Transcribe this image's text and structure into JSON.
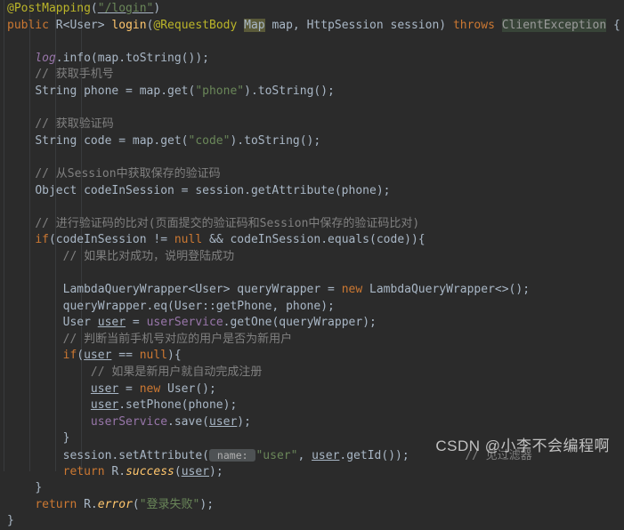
{
  "editor": {
    "language": "java",
    "theme": "darcula",
    "background": "#2b2b2b",
    "default_text_color": "#a9b7c6",
    "colors": {
      "keyword": "#cc7832",
      "annotation": "#bbb529",
      "string": "#6a8759",
      "comment": "#808080",
      "field": "#9876aa",
      "method": "#ffc66d",
      "identifier": "#a9b7c6",
      "usage_highlight_bg": "#5a5a39",
      "exception_highlight_bg": "#384438",
      "param_hint_bg": "#4e5254"
    },
    "indent_guides": [
      4,
      33,
      62,
      91
    ]
  },
  "code": {
    "lines": [
      {
        "indent": 0,
        "tokens": [
          {
            "t": "@PostMapping",
            "c": "ann"
          },
          {
            "t": "(",
            "c": "id"
          },
          {
            "t": "\"/login\"",
            "c": "str",
            "underline": true
          },
          {
            "t": ")",
            "c": "id"
          }
        ]
      },
      {
        "indent": 0,
        "tokens": [
          {
            "t": "public",
            "c": "kw"
          },
          {
            "t": " R<User> ",
            "c": "id"
          },
          {
            "t": "login",
            "c": "mtd"
          },
          {
            "t": "(",
            "c": "id"
          },
          {
            "t": "@RequestBody",
            "c": "ann"
          },
          {
            "t": " ",
            "c": "id"
          },
          {
            "t": "Map",
            "c": "hl-map"
          },
          {
            "t": " map, HttpSession session) ",
            "c": "id"
          },
          {
            "t": "throws",
            "c": "kw"
          },
          {
            "t": " ",
            "c": "id"
          },
          {
            "t": "ClientException",
            "c": "hl-exc"
          },
          {
            "t": " {",
            "c": "id"
          }
        ]
      },
      {
        "indent": 0,
        "tokens": []
      },
      {
        "indent": 1,
        "tokens": [
          {
            "t": "log",
            "c": "stat"
          },
          {
            "t": ".info(map.toString());",
            "c": "id"
          }
        ]
      },
      {
        "indent": 1,
        "tokens": [
          {
            "t": "// 获取手机号",
            "c": "cmt"
          }
        ]
      },
      {
        "indent": 1,
        "tokens": [
          {
            "t": "String phone = map.get(",
            "c": "id"
          },
          {
            "t": "\"phone\"",
            "c": "str"
          },
          {
            "t": ").toString();",
            "c": "id"
          }
        ]
      },
      {
        "indent": 0,
        "tokens": []
      },
      {
        "indent": 1,
        "tokens": [
          {
            "t": "// 获取验证码",
            "c": "cmt"
          }
        ]
      },
      {
        "indent": 1,
        "tokens": [
          {
            "t": "String code = map.get(",
            "c": "id"
          },
          {
            "t": "\"code\"",
            "c": "str"
          },
          {
            "t": ").toString();",
            "c": "id"
          }
        ]
      },
      {
        "indent": 0,
        "tokens": []
      },
      {
        "indent": 1,
        "tokens": [
          {
            "t": "// 从Session中获取保存的验证码",
            "c": "cmt"
          }
        ]
      },
      {
        "indent": 1,
        "tokens": [
          {
            "t": "Object codeInSession = session.getAttribute(phone);",
            "c": "id"
          }
        ]
      },
      {
        "indent": 0,
        "tokens": []
      },
      {
        "indent": 1,
        "tokens": [
          {
            "t": "// 进行验证码的比对(页面提交的验证码和Session中保存的验证码比对)",
            "c": "cmt"
          }
        ]
      },
      {
        "indent": 1,
        "tokens": [
          {
            "t": "if",
            "c": "kw"
          },
          {
            "t": "(codeInSession != ",
            "c": "id"
          },
          {
            "t": "null",
            "c": "kw"
          },
          {
            "t": " && codeInSession.equals(code)){",
            "c": "id"
          }
        ]
      },
      {
        "indent": 2,
        "tokens": [
          {
            "t": "// 如果比对成功，说明登陆成功",
            "c": "cmt"
          }
        ]
      },
      {
        "indent": 0,
        "tokens": []
      },
      {
        "indent": 2,
        "tokens": [
          {
            "t": "LambdaQueryWrapper<User> queryWrapper = ",
            "c": "id"
          },
          {
            "t": "new",
            "c": "kw"
          },
          {
            "t": " LambdaQueryWrapper<>();",
            "c": "id"
          }
        ]
      },
      {
        "indent": 2,
        "tokens": [
          {
            "t": "queryWrapper.eq(User::getPhone, phone);",
            "c": "id"
          }
        ]
      },
      {
        "indent": 2,
        "tokens": [
          {
            "t": "User ",
            "c": "id"
          },
          {
            "t": "user",
            "c": "id",
            "underline": true
          },
          {
            "t": " = ",
            "c": "id"
          },
          {
            "t": "userService",
            "c": "fld"
          },
          {
            "t": ".getOne(queryWrapper);",
            "c": "id"
          }
        ]
      },
      {
        "indent": 2,
        "tokens": [
          {
            "t": "// 判断当前手机号对应的用户是否为新用户",
            "c": "cmt"
          }
        ]
      },
      {
        "indent": 2,
        "tokens": [
          {
            "t": "if",
            "c": "kw"
          },
          {
            "t": "(",
            "c": "id"
          },
          {
            "t": "user",
            "c": "id",
            "underline": true
          },
          {
            "t": " == ",
            "c": "id"
          },
          {
            "t": "null",
            "c": "kw"
          },
          {
            "t": "){",
            "c": "id"
          }
        ]
      },
      {
        "indent": 3,
        "tokens": [
          {
            "t": "// 如果是新用户就自动完成注册",
            "c": "cmt"
          }
        ]
      },
      {
        "indent": 3,
        "tokens": [
          {
            "t": "user",
            "c": "id",
            "underline": true
          },
          {
            "t": " = ",
            "c": "id"
          },
          {
            "t": "new",
            "c": "kw"
          },
          {
            "t": " User();",
            "c": "id"
          }
        ]
      },
      {
        "indent": 3,
        "tokens": [
          {
            "t": "user",
            "c": "id",
            "underline": true
          },
          {
            "t": ".setPhone(phone);",
            "c": "id"
          }
        ]
      },
      {
        "indent": 3,
        "tokens": [
          {
            "t": "userService",
            "c": "fld"
          },
          {
            "t": ".save(",
            "c": "id"
          },
          {
            "t": "user",
            "c": "id",
            "underline": true
          },
          {
            "t": ");",
            "c": "id"
          }
        ]
      },
      {
        "indent": 2,
        "tokens": [
          {
            "t": "}",
            "c": "id"
          }
        ]
      },
      {
        "indent": 2,
        "tokens": [
          {
            "t": "session.setAttribute(",
            "c": "id"
          },
          {
            "t": " name: ",
            "c": "hint"
          },
          {
            "t": "\"user\"",
            "c": "str"
          },
          {
            "t": ", ",
            "c": "id"
          },
          {
            "t": "user",
            "c": "id",
            "underline": true
          },
          {
            "t": ".getId());",
            "c": "id"
          },
          {
            "t": "        ",
            "c": "id"
          },
          {
            "t": "// 见过滤器",
            "c": "cmt"
          }
        ]
      },
      {
        "indent": 2,
        "tokens": [
          {
            "t": "return",
            "c": "kw"
          },
          {
            "t": " R.",
            "c": "id"
          },
          {
            "t": "success",
            "c": "mtdi"
          },
          {
            "t": "(",
            "c": "id"
          },
          {
            "t": "user",
            "c": "id",
            "underline": true
          },
          {
            "t": ");",
            "c": "id"
          }
        ]
      },
      {
        "indent": 1,
        "tokens": [
          {
            "t": "}",
            "c": "id"
          }
        ]
      },
      {
        "indent": 1,
        "tokens": [
          {
            "t": "return",
            "c": "kw"
          },
          {
            "t": " R.",
            "c": "id"
          },
          {
            "t": "error",
            "c": "mtdi"
          },
          {
            "t": "(",
            "c": "id"
          },
          {
            "t": "\"登录失败\"",
            "c": "str"
          },
          {
            "t": ");",
            "c": "id"
          }
        ]
      },
      {
        "indent": 0,
        "tokens": [
          {
            "t": "}",
            "c": "id"
          }
        ]
      }
    ]
  },
  "watermark": {
    "text": "CSDN @小李不会编程啊"
  }
}
